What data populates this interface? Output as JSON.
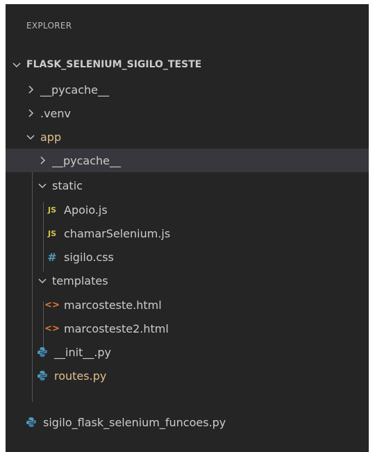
{
  "explorer": {
    "header": "EXPLORER",
    "root_label": "FLASK_SELENIUM_SIGILO_TESTE",
    "items": {
      "pycache_root": {
        "label": "__pycache__"
      },
      "venv": {
        "label": ".venv"
      },
      "app": {
        "label": "app",
        "status_color": "#e2c08d"
      },
      "app_pycache": {
        "label": "__pycache__"
      },
      "static": {
        "label": "static"
      },
      "apoio": {
        "label": "Apoio.js",
        "icon": "JS"
      },
      "chamar": {
        "label": "chamarSelenium.js",
        "icon": "JS"
      },
      "sigilo_css": {
        "label": "sigilo.css",
        "icon": "#"
      },
      "templates": {
        "label": "templates"
      },
      "marcos1": {
        "label": "marcosteste.html",
        "icon": "<>"
      },
      "marcos2": {
        "label": "marcosteste2.html",
        "icon": "<>"
      },
      "init_py": {
        "label": "__init__.py"
      },
      "routes_py": {
        "label": "routes.py"
      },
      "funcoes_py": {
        "label": "sigilo_flask_selenium_funcoes.py"
      }
    }
  }
}
